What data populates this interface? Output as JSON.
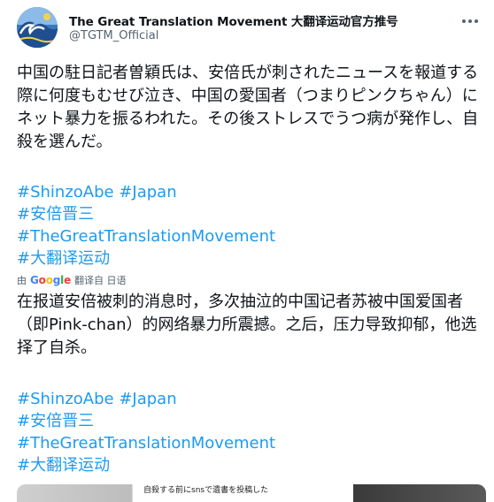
{
  "account": {
    "display_name": "The Great Translation Movement 大翻译运动官方推号",
    "handle": "@TGTM_Official",
    "avatar_icon": "great-wave-avatar-icon"
  },
  "tweet": {
    "original_text": "中国の駐日記者曽穎氏は、安倍氏が刺されたニュースを報道する際に何度もむせび泣き、中国の愛国者（つまりピンクちゃん）にネット暴力を振るわれた。その後ストレスでうつ病が発作し、自殺を選んだ。",
    "hashtags_original": [
      "#ShinzoAbe #Japan",
      "#安倍晋三",
      "#TheGreatTranslationMovement",
      "#大翻译运动"
    ],
    "translation_bar": {
      "prefix": "由",
      "provider": "Google",
      "suffix": "翻译自 日语"
    },
    "translated_text": "在报道安倍被刺的消息时，多次抽泣的中国记者苏被中国爱国者（即Pink-chan）的网络暴力所震撼。之后，压力导致抑郁，他选择了自杀。",
    "hashtags_translated": [
      "#ShinzoAbe #Japan",
      "#安倍晋三",
      "#TheGreatTranslationMovement",
      "#大翻译运动"
    ],
    "media_caption": "自殺する前にsnsで遺書を投稿した"
  },
  "colors": {
    "link": "#1d9bf0",
    "text": "#0f1419",
    "secondary": "#536471"
  }
}
